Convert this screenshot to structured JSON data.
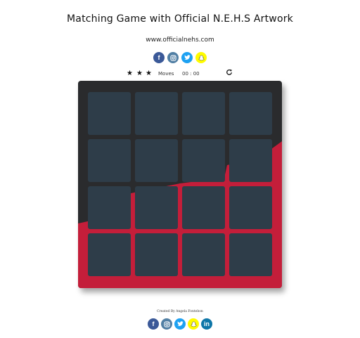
{
  "header": {
    "title": "Matching Game with Official N.E.H.S Artwork",
    "site_url": "www.officialnehs.com"
  },
  "social_top": [
    {
      "name": "facebook",
      "glyph": "f",
      "color": "#3b5998"
    },
    {
      "name": "instagram",
      "glyph": "instagram-icon",
      "color": "#517fa4"
    },
    {
      "name": "twitter",
      "glyph": "twitter-icon",
      "color": "#1da1f2"
    },
    {
      "name": "snapchat",
      "glyph": "snapchat-icon",
      "color": "#fffc00"
    }
  ],
  "score_panel": {
    "stars": [
      "★",
      "★",
      "★"
    ],
    "moves_label": "Moves",
    "timer": "00 : 00",
    "restart_icon": "repeat-icon"
  },
  "deck": {
    "colors": {
      "dark": "#2a2b2d",
      "red": "#c41e3a",
      "card": "#2e3d49"
    },
    "rows": 4,
    "cols": 4,
    "cards_face_down": 16
  },
  "footer": {
    "credit": "Created By Angela Fontebon",
    "social": [
      {
        "name": "facebook",
        "glyph": "f",
        "color": "#3b5998"
      },
      {
        "name": "instagram",
        "glyph": "instagram-icon",
        "color": "#517fa4"
      },
      {
        "name": "twitter",
        "glyph": "twitter-icon",
        "color": "#1da1f2"
      },
      {
        "name": "snapchat",
        "glyph": "snapchat-icon",
        "color": "#fffc00"
      },
      {
        "name": "linkedin",
        "glyph": "in",
        "color": "#0e76a8"
      }
    ]
  }
}
